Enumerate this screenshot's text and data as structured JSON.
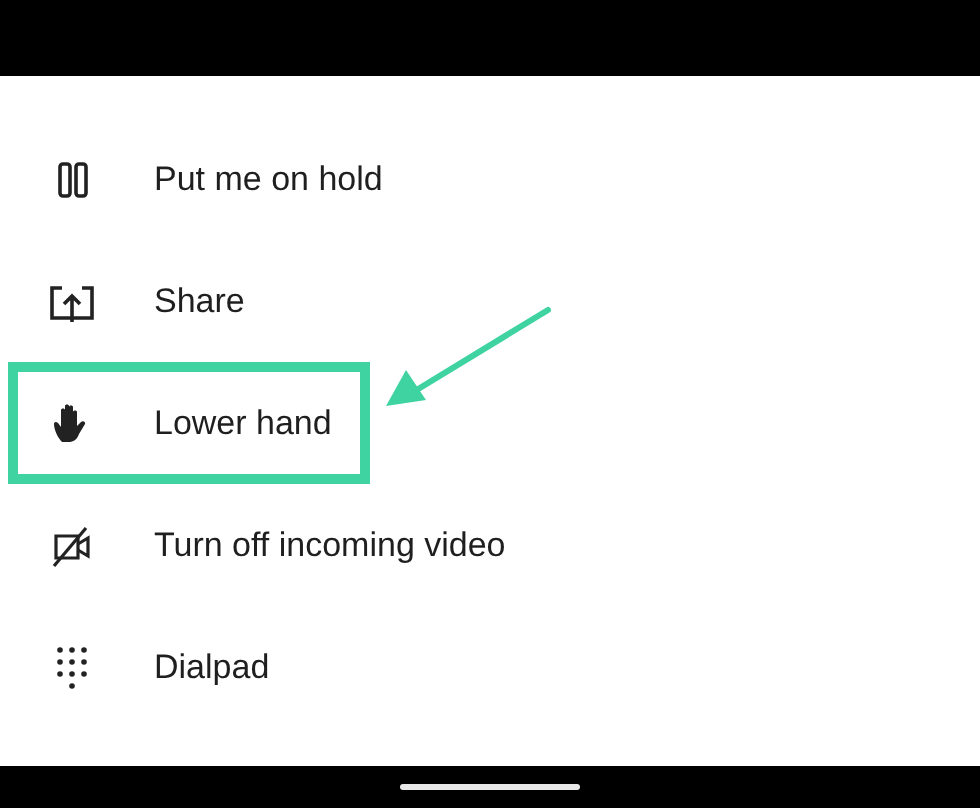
{
  "menu": {
    "items": [
      {
        "kind": "hold",
        "label": "Put me on hold",
        "highlighted": false
      },
      {
        "kind": "share",
        "label": "Share",
        "highlighted": false
      },
      {
        "kind": "hand",
        "label": "Lower hand",
        "highlighted": true
      },
      {
        "kind": "video-off",
        "label": "Turn off incoming video",
        "highlighted": false
      },
      {
        "kind": "dialpad",
        "label": "Dialpad",
        "highlighted": false
      }
    ]
  }
}
